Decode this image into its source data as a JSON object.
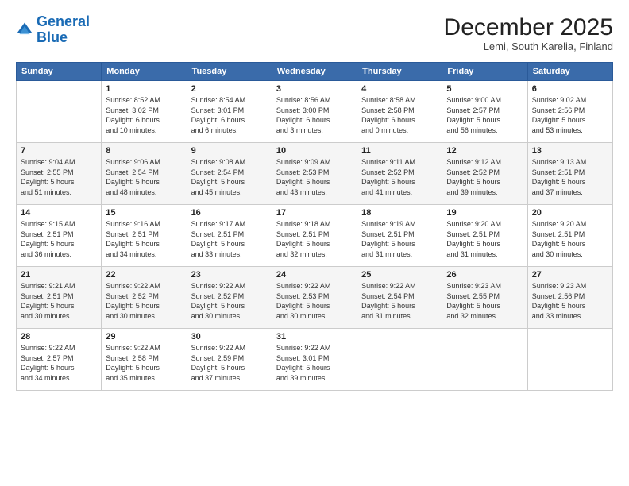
{
  "header": {
    "logo_line1": "General",
    "logo_line2": "Blue",
    "month": "December 2025",
    "location": "Lemi, South Karelia, Finland"
  },
  "weekdays": [
    "Sunday",
    "Monday",
    "Tuesday",
    "Wednesday",
    "Thursday",
    "Friday",
    "Saturday"
  ],
  "weeks": [
    [
      {
        "day": "",
        "info": ""
      },
      {
        "day": "1",
        "info": "Sunrise: 8:52 AM\nSunset: 3:02 PM\nDaylight: 6 hours\nand 10 minutes."
      },
      {
        "day": "2",
        "info": "Sunrise: 8:54 AM\nSunset: 3:01 PM\nDaylight: 6 hours\nand 6 minutes."
      },
      {
        "day": "3",
        "info": "Sunrise: 8:56 AM\nSunset: 3:00 PM\nDaylight: 6 hours\nand 3 minutes."
      },
      {
        "day": "4",
        "info": "Sunrise: 8:58 AM\nSunset: 2:58 PM\nDaylight: 6 hours\nand 0 minutes."
      },
      {
        "day": "5",
        "info": "Sunrise: 9:00 AM\nSunset: 2:57 PM\nDaylight: 5 hours\nand 56 minutes."
      },
      {
        "day": "6",
        "info": "Sunrise: 9:02 AM\nSunset: 2:56 PM\nDaylight: 5 hours\nand 53 minutes."
      }
    ],
    [
      {
        "day": "7",
        "info": "Sunrise: 9:04 AM\nSunset: 2:55 PM\nDaylight: 5 hours\nand 51 minutes."
      },
      {
        "day": "8",
        "info": "Sunrise: 9:06 AM\nSunset: 2:54 PM\nDaylight: 5 hours\nand 48 minutes."
      },
      {
        "day": "9",
        "info": "Sunrise: 9:08 AM\nSunset: 2:54 PM\nDaylight: 5 hours\nand 45 minutes."
      },
      {
        "day": "10",
        "info": "Sunrise: 9:09 AM\nSunset: 2:53 PM\nDaylight: 5 hours\nand 43 minutes."
      },
      {
        "day": "11",
        "info": "Sunrise: 9:11 AM\nSunset: 2:52 PM\nDaylight: 5 hours\nand 41 minutes."
      },
      {
        "day": "12",
        "info": "Sunrise: 9:12 AM\nSunset: 2:52 PM\nDaylight: 5 hours\nand 39 minutes."
      },
      {
        "day": "13",
        "info": "Sunrise: 9:13 AM\nSunset: 2:51 PM\nDaylight: 5 hours\nand 37 minutes."
      }
    ],
    [
      {
        "day": "14",
        "info": "Sunrise: 9:15 AM\nSunset: 2:51 PM\nDaylight: 5 hours\nand 36 minutes."
      },
      {
        "day": "15",
        "info": "Sunrise: 9:16 AM\nSunset: 2:51 PM\nDaylight: 5 hours\nand 34 minutes."
      },
      {
        "day": "16",
        "info": "Sunrise: 9:17 AM\nSunset: 2:51 PM\nDaylight: 5 hours\nand 33 minutes."
      },
      {
        "day": "17",
        "info": "Sunrise: 9:18 AM\nSunset: 2:51 PM\nDaylight: 5 hours\nand 32 minutes."
      },
      {
        "day": "18",
        "info": "Sunrise: 9:19 AM\nSunset: 2:51 PM\nDaylight: 5 hours\nand 31 minutes."
      },
      {
        "day": "19",
        "info": "Sunrise: 9:20 AM\nSunset: 2:51 PM\nDaylight: 5 hours\nand 31 minutes."
      },
      {
        "day": "20",
        "info": "Sunrise: 9:20 AM\nSunset: 2:51 PM\nDaylight: 5 hours\nand 30 minutes."
      }
    ],
    [
      {
        "day": "21",
        "info": "Sunrise: 9:21 AM\nSunset: 2:51 PM\nDaylight: 5 hours\nand 30 minutes."
      },
      {
        "day": "22",
        "info": "Sunrise: 9:22 AM\nSunset: 2:52 PM\nDaylight: 5 hours\nand 30 minutes."
      },
      {
        "day": "23",
        "info": "Sunrise: 9:22 AM\nSunset: 2:52 PM\nDaylight: 5 hours\nand 30 minutes."
      },
      {
        "day": "24",
        "info": "Sunrise: 9:22 AM\nSunset: 2:53 PM\nDaylight: 5 hours\nand 30 minutes."
      },
      {
        "day": "25",
        "info": "Sunrise: 9:22 AM\nSunset: 2:54 PM\nDaylight: 5 hours\nand 31 minutes."
      },
      {
        "day": "26",
        "info": "Sunrise: 9:23 AM\nSunset: 2:55 PM\nDaylight: 5 hours\nand 32 minutes."
      },
      {
        "day": "27",
        "info": "Sunrise: 9:23 AM\nSunset: 2:56 PM\nDaylight: 5 hours\nand 33 minutes."
      }
    ],
    [
      {
        "day": "28",
        "info": "Sunrise: 9:22 AM\nSunset: 2:57 PM\nDaylight: 5 hours\nand 34 minutes."
      },
      {
        "day": "29",
        "info": "Sunrise: 9:22 AM\nSunset: 2:58 PM\nDaylight: 5 hours\nand 35 minutes."
      },
      {
        "day": "30",
        "info": "Sunrise: 9:22 AM\nSunset: 2:59 PM\nDaylight: 5 hours\nand 37 minutes."
      },
      {
        "day": "31",
        "info": "Sunrise: 9:22 AM\nSunset: 3:01 PM\nDaylight: 5 hours\nand 39 minutes."
      },
      {
        "day": "",
        "info": ""
      },
      {
        "day": "",
        "info": ""
      },
      {
        "day": "",
        "info": ""
      }
    ]
  ]
}
